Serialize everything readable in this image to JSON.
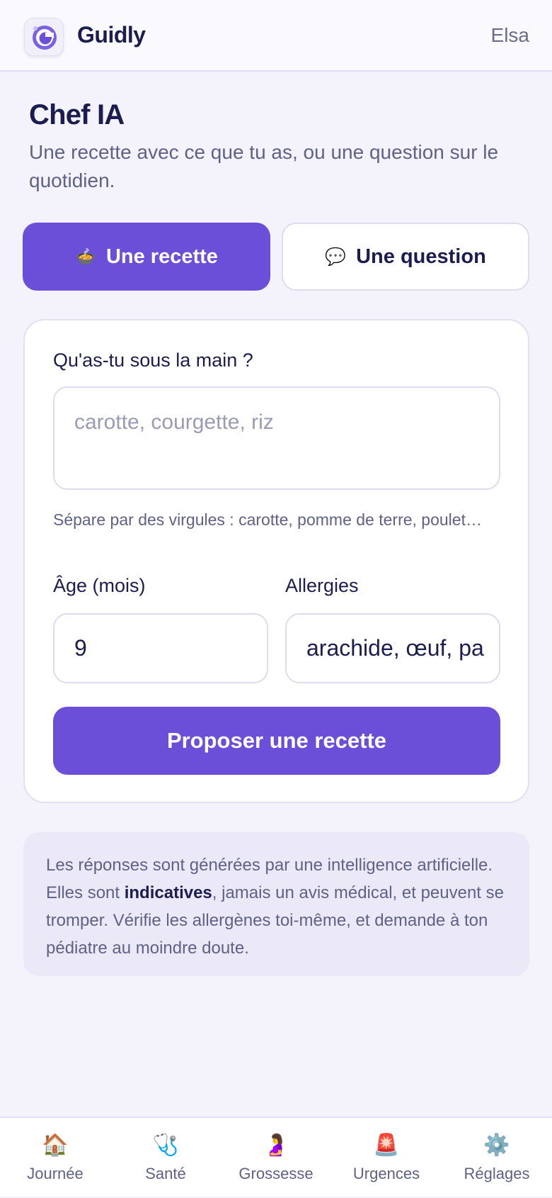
{
  "header": {
    "app_name": "Guidly",
    "user_name": "Elsa"
  },
  "page": {
    "title": "Chef IA",
    "subtitle": "Une recette avec ce que tu as, ou une question sur le quotidien."
  },
  "tabs": [
    {
      "icon": "🍲",
      "icon_name": "cooking-pot-icon",
      "label": "Une recette",
      "active": true
    },
    {
      "icon": "💬",
      "icon_name": "speech-bubble-icon",
      "label": "Une question",
      "active": false
    }
  ],
  "form": {
    "ingredients_label": "Qu'as-tu sous la main ?",
    "ingredients_placeholder": "carotte, courgette, riz",
    "ingredients_hint": "Sépare par des virgules : carotte, pomme de terre, poulet…",
    "age_label": "Âge (mois)",
    "age_value": "9",
    "allergies_label": "Allergies",
    "allergies_value": "arachide, œuf, pa",
    "submit_label": "Proposer une recette"
  },
  "disclaimer": {
    "text_before": "Les réponses sont générées par une intelligence artificielle. Elles sont ",
    "bold": "indicatives",
    "text_after": ", jamais un avis médical, et peuvent se tromper. Vérifie les allergènes toi-même, et demande à ton pédiatre au moindre doute."
  },
  "nav": [
    {
      "icon": "🏠",
      "icon_name": "house-icon",
      "label": "Journée"
    },
    {
      "icon": "🩺",
      "icon_name": "stethoscope-icon",
      "label": "Santé"
    },
    {
      "icon": "🤰",
      "icon_name": "pregnant-woman-icon",
      "label": "Grossesse"
    },
    {
      "icon": "🚨",
      "icon_name": "siren-icon",
      "label": "Urgences"
    },
    {
      "icon": "⚙️",
      "icon_name": "gear-icon",
      "label": "Réglages"
    }
  ],
  "colors": {
    "accent": "#6b4fd8",
    "background": "#f4f3fc",
    "text": "#1c1d4f"
  }
}
